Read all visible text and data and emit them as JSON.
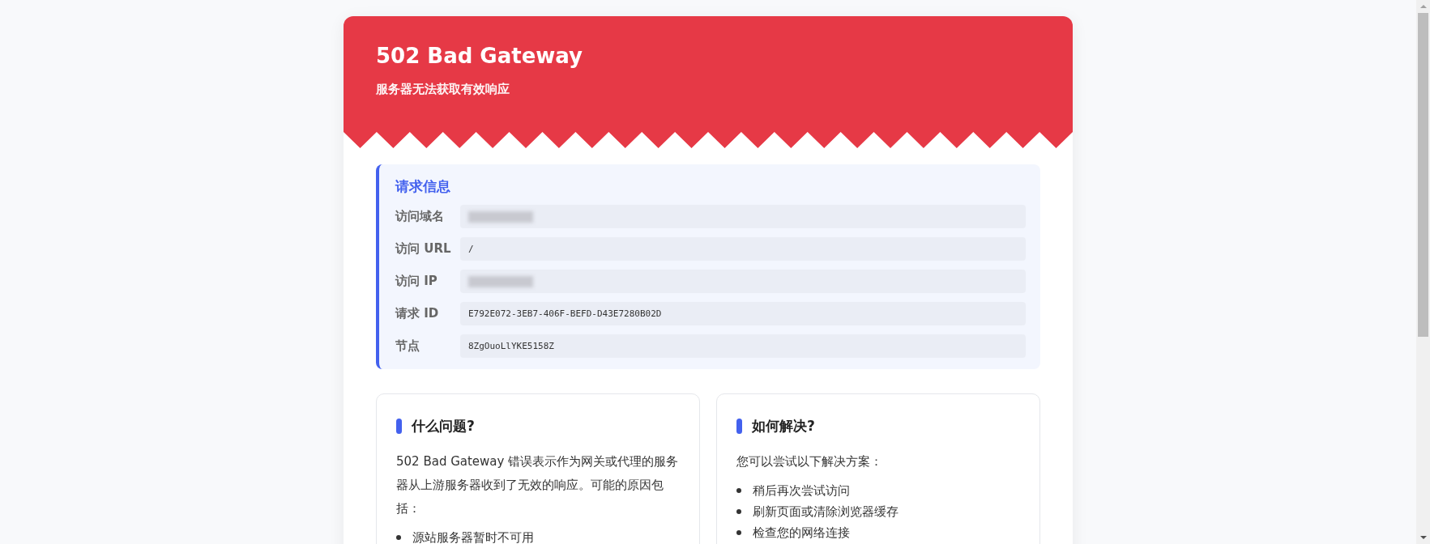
{
  "header": {
    "title": "502 Bad Gateway",
    "subtitle": "服务器无法获取有效响应"
  },
  "request_info": {
    "title": "请求信息",
    "rows": [
      {
        "label": "访问域名",
        "redacted": true
      },
      {
        "label": "访问 URL",
        "value": "/",
        "redacted": false
      },
      {
        "label": "访问 IP",
        "redacted": true
      },
      {
        "label": "请求 ID",
        "value": "E792E072-3EB7-406F-BEFD-D43E7280B02D",
        "redacted": false
      },
      {
        "label": "节点",
        "value": "8ZgOuoLlYKE5158Z",
        "redacted": false
      }
    ]
  },
  "cards": [
    {
      "title": "什么问题?",
      "text": "502 Bad Gateway 错误表示作为网关或代理的服务器从上游服务器收到了无效的响应。可能的原因包括：",
      "items": [
        "源站服务器暂时不可用"
      ]
    },
    {
      "title": "如何解决?",
      "text": "您可以尝试以下解决方案：",
      "items": [
        "稍后再次尝试访问",
        "刷新页面或清除浏览器缓存",
        "检查您的网络连接"
      ]
    }
  ]
}
